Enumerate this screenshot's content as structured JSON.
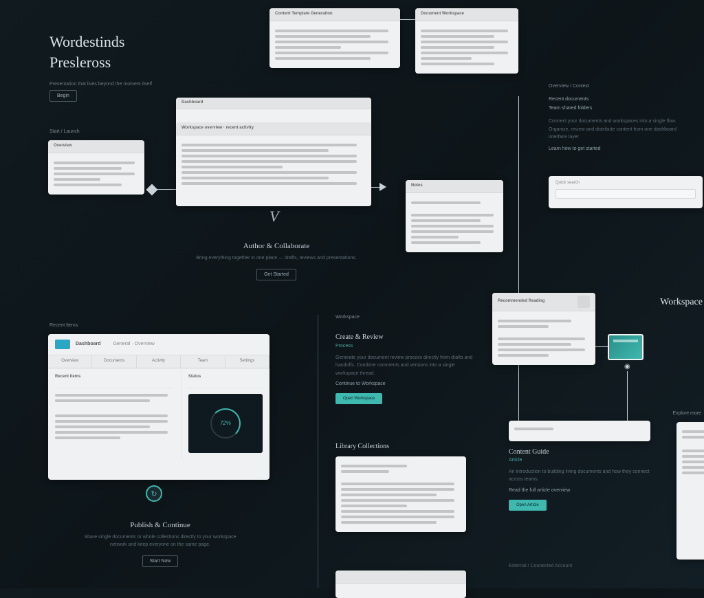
{
  "brand": {
    "line1": "Wordestinds",
    "line2": "Presleross"
  },
  "intro": {
    "subtext": "Presentation that lives beyond the moment itself",
    "button": "Begin"
  },
  "left_label": "Start / Launch",
  "cards": {
    "top_left": {
      "title": "Content Template Generation",
      "lines": 6
    },
    "top_right": {
      "title": "Document Workspace",
      "lines": 7
    },
    "small_left": {
      "title": "Overview",
      "lines": 5
    },
    "wide_mid": {
      "tab": "Dashboard",
      "header": "Workspace overview · recent activity",
      "lines": 9
    },
    "mid_small": {
      "title": "Notes",
      "lines": 6
    },
    "right_list": {
      "title": "Recommended Reading",
      "lines": 6
    },
    "input_card": {
      "label_a": "Quick search",
      "label_b": ""
    },
    "bottom_list": {
      "title": "",
      "lines": 8
    }
  },
  "side_note": {
    "label": "Overview / Context",
    "l1": "Recent documents",
    "l2": "Team shared folders",
    "paragraph": "Connect your documents and workspaces into a single flow. Organize, review and distribute content from one dashboard interface layer.",
    "tail": "Learn how to get started"
  },
  "cta_mid": {
    "title": "Author & Collaborate",
    "sub": "Bring everything together in one place — drafts, reviews and presentations.",
    "button": "Get Started"
  },
  "feature_a": {
    "label": "Workspace",
    "title": "Create & Review",
    "tag": "Process",
    "paragraph": "Generate your document review process directly from drafts and handoffs. Combine comments and versions into a single workspace thread.",
    "link": "Continue to Workspace",
    "button": "Open Workspace"
  },
  "feature_b": {
    "title": "Library Collections",
    "lines": 7
  },
  "feature_c": {
    "title": "Content Guide",
    "tag": "Article",
    "paragraph": "An introduction to building living documents and how they connect across teams.",
    "link": "Read the full article overview",
    "button": "Open Article"
  },
  "dashboard": {
    "icon_label": "Dashboard",
    "nav_label": "General · Overview",
    "tabs": [
      "Overview",
      "Documents",
      "Activity",
      "Team",
      "Settings"
    ],
    "col_a": "Recent Items",
    "col_b": "Status",
    "ring_label": "72%"
  },
  "cta_bottom": {
    "title": "Publish & Continue",
    "sub": "Share single documents or whole collections directly to your workspace network and keep everyone on the same page.",
    "button": "Start Now"
  },
  "right_edge_heading": "Workspace",
  "right_edge_label": "Explore more",
  "bottom_right_label": "External / Connected Account",
  "icons": {
    "refresh": "↻",
    "node": "◉"
  }
}
